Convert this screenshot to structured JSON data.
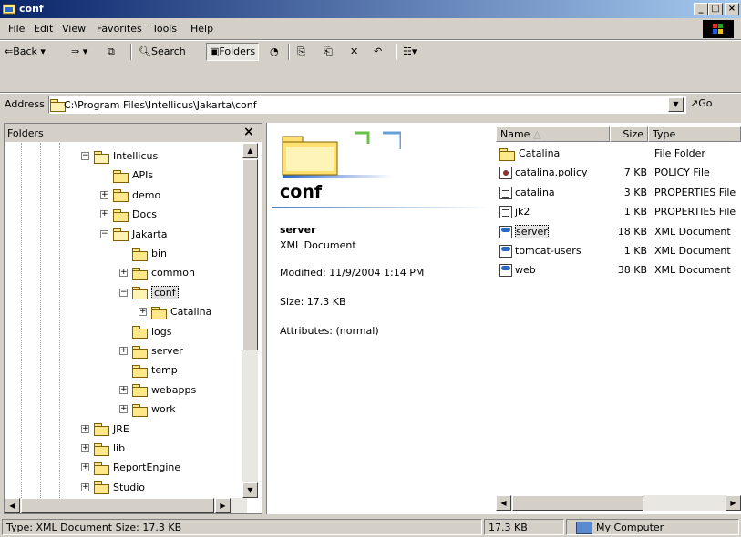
{
  "window": {
    "title": "conf"
  },
  "menu": [
    "File",
    "Edit",
    "View",
    "Favorites",
    "Tools",
    "Help"
  ],
  "toolbar": {
    "back": "Back",
    "search": "Search",
    "folders": "Folders"
  },
  "address": {
    "label": "Address",
    "value": "C:\\Program Files\\Intellicus\\Jakarta\\conf",
    "go": "Go"
  },
  "folders_pane": {
    "title": "Folders",
    "items": [
      {
        "label": "Intellicus",
        "depth": 0,
        "expander": "-",
        "open": true
      },
      {
        "label": "APIs",
        "depth": 1,
        "expander": ""
      },
      {
        "label": "demo",
        "depth": 1,
        "expander": "+"
      },
      {
        "label": "Docs",
        "depth": 1,
        "expander": "+"
      },
      {
        "label": "Jakarta",
        "depth": 1,
        "expander": "-",
        "open": true
      },
      {
        "label": "bin",
        "depth": 2,
        "expander": ""
      },
      {
        "label": "common",
        "depth": 2,
        "expander": "+"
      },
      {
        "label": "conf",
        "depth": 2,
        "expander": "-",
        "open": true,
        "selected": true
      },
      {
        "label": "Catalina",
        "depth": 3,
        "expander": "+"
      },
      {
        "label": "logs",
        "depth": 2,
        "expander": ""
      },
      {
        "label": "server",
        "depth": 2,
        "expander": "+"
      },
      {
        "label": "temp",
        "depth": 2,
        "expander": ""
      },
      {
        "label": "webapps",
        "depth": 2,
        "expander": "+"
      },
      {
        "label": "work",
        "depth": 2,
        "expander": "+"
      },
      {
        "label": "JRE",
        "depth": 0,
        "expander": "+"
      },
      {
        "label": "lib",
        "depth": 0,
        "expander": "+"
      },
      {
        "label": "ReportEngine",
        "depth": 0,
        "expander": "+"
      },
      {
        "label": "Studio",
        "depth": 0,
        "expander": "+"
      }
    ]
  },
  "details": {
    "folder_title": "conf",
    "selected_name": "server",
    "selected_type": "XML Document",
    "modified": "Modified: 11/9/2004 1:14 PM",
    "size": "Size: 17.3 KB",
    "attributes": "Attributes: (normal)"
  },
  "file_list": {
    "columns": [
      "Name",
      "Size",
      "Type"
    ],
    "rows": [
      {
        "name": "Catalina",
        "size": "",
        "type": "File Folder",
        "icon": "folder-icon"
      },
      {
        "name": "catalina.policy",
        "size": "7 KB",
        "type": "POLICY File",
        "icon": "policy-file-icon"
      },
      {
        "name": "catalina",
        "size": "3 KB",
        "type": "PROPERTIES File",
        "icon": "properties-file-icon"
      },
      {
        "name": "jk2",
        "size": "1 KB",
        "type": "PROPERTIES File",
        "icon": "properties-file-icon"
      },
      {
        "name": "server",
        "size": "18 KB",
        "type": "XML Document",
        "icon": "xml-file-icon",
        "selected": true
      },
      {
        "name": "tomcat-users",
        "size": "1 KB",
        "type": "XML Document",
        "icon": "xml-file-icon"
      },
      {
        "name": "web",
        "size": "38 KB",
        "type": "XML Document",
        "icon": "xml-file-icon"
      }
    ]
  },
  "status": {
    "left": "Type: XML Document Size: 17.3 KB",
    "size": "17.3 KB",
    "zone": "My Computer"
  }
}
